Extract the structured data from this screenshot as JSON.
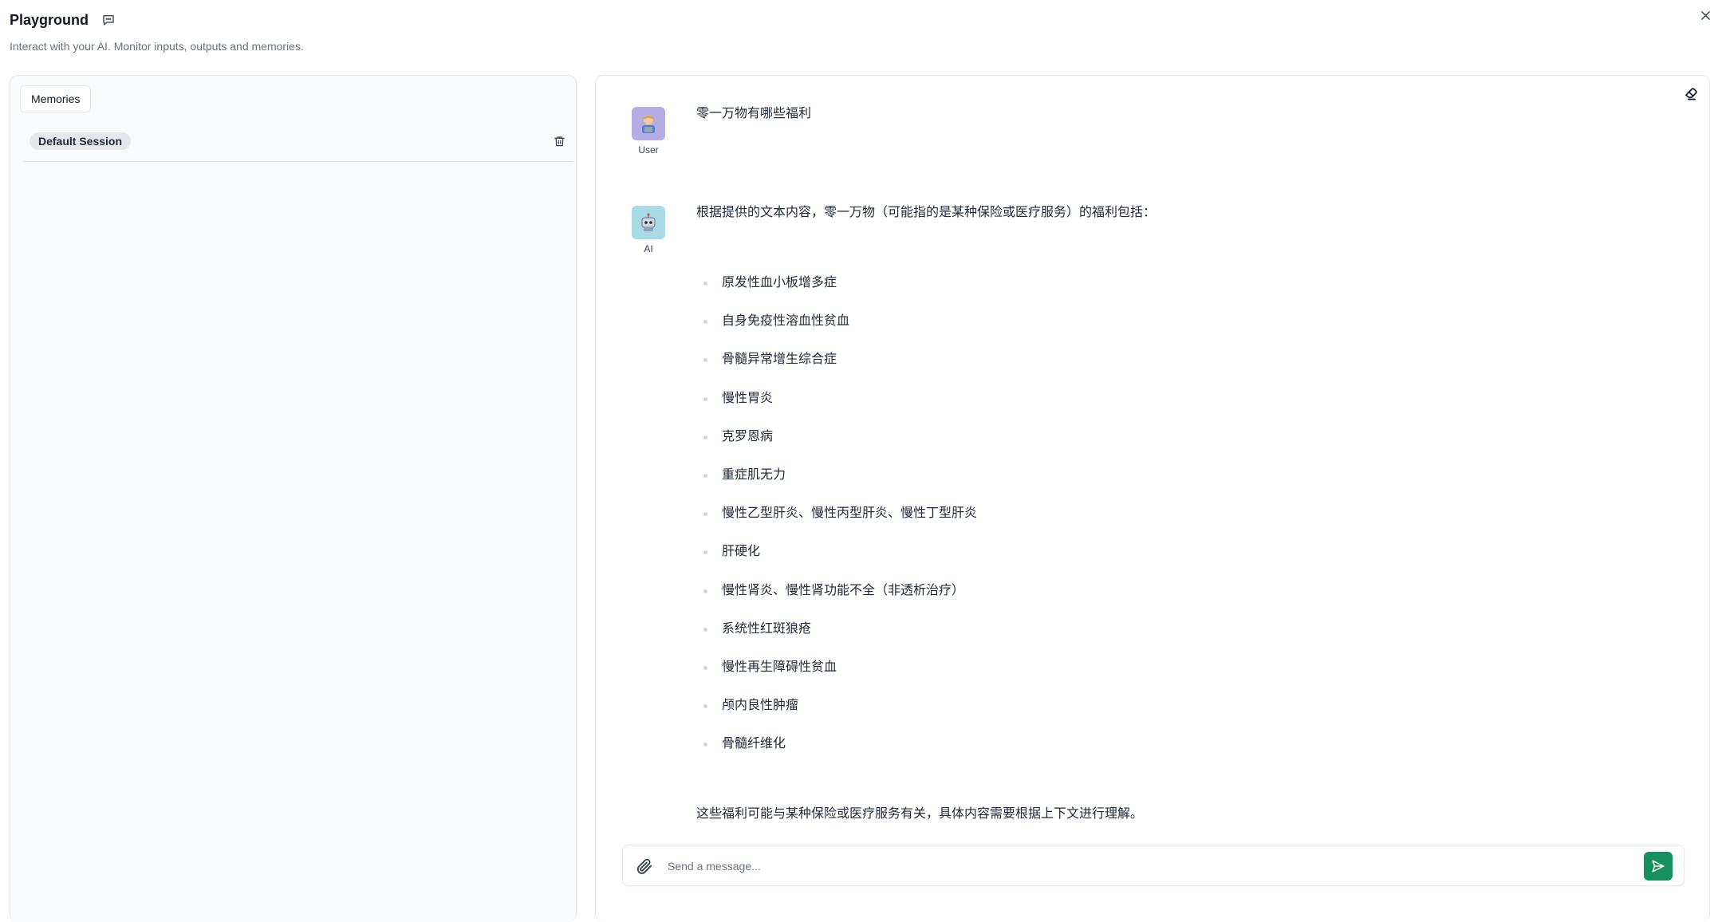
{
  "app": {
    "title": "Playground",
    "subtitle": "Interact with your AI. Monitor inputs, outputs and memories.",
    "accent_color": "#16915d"
  },
  "left_panel": {
    "memories_button": "Memories",
    "sessions": [
      {
        "label": "Default Session"
      }
    ]
  },
  "chat": {
    "messages": [
      {
        "role": "User",
        "avatar_icon": "user-avatar-icon",
        "text": "零一万物有哪些福利"
      },
      {
        "role": "AI",
        "avatar_icon": "robot-avatar-icon",
        "intro": "根据提供的文本内容，零一万物（可能指的是某种保险或医疗服务）的福利包括：",
        "items": [
          "原发性血小板增多症",
          "自身免疫性溶血性贫血",
          "骨髓异常增生综合症",
          "慢性胃炎",
          "克罗恩病",
          "重症肌无力",
          "慢性乙型肝炎、慢性丙型肝炎、慢性丁型肝炎",
          "肝硬化",
          "慢性肾炎、慢性肾功能不全（非透析治疗）",
          "系统性红斑狼疮",
          "慢性再生障碍性贫血",
          "颅内良性肿瘤",
          "骨髓纤维化"
        ],
        "outro": "这些福利可能与某种保险或医疗服务有关，具体内容需要根据上下文进行理解。"
      }
    ]
  },
  "input": {
    "value": "",
    "placeholder": "Send a message..."
  }
}
